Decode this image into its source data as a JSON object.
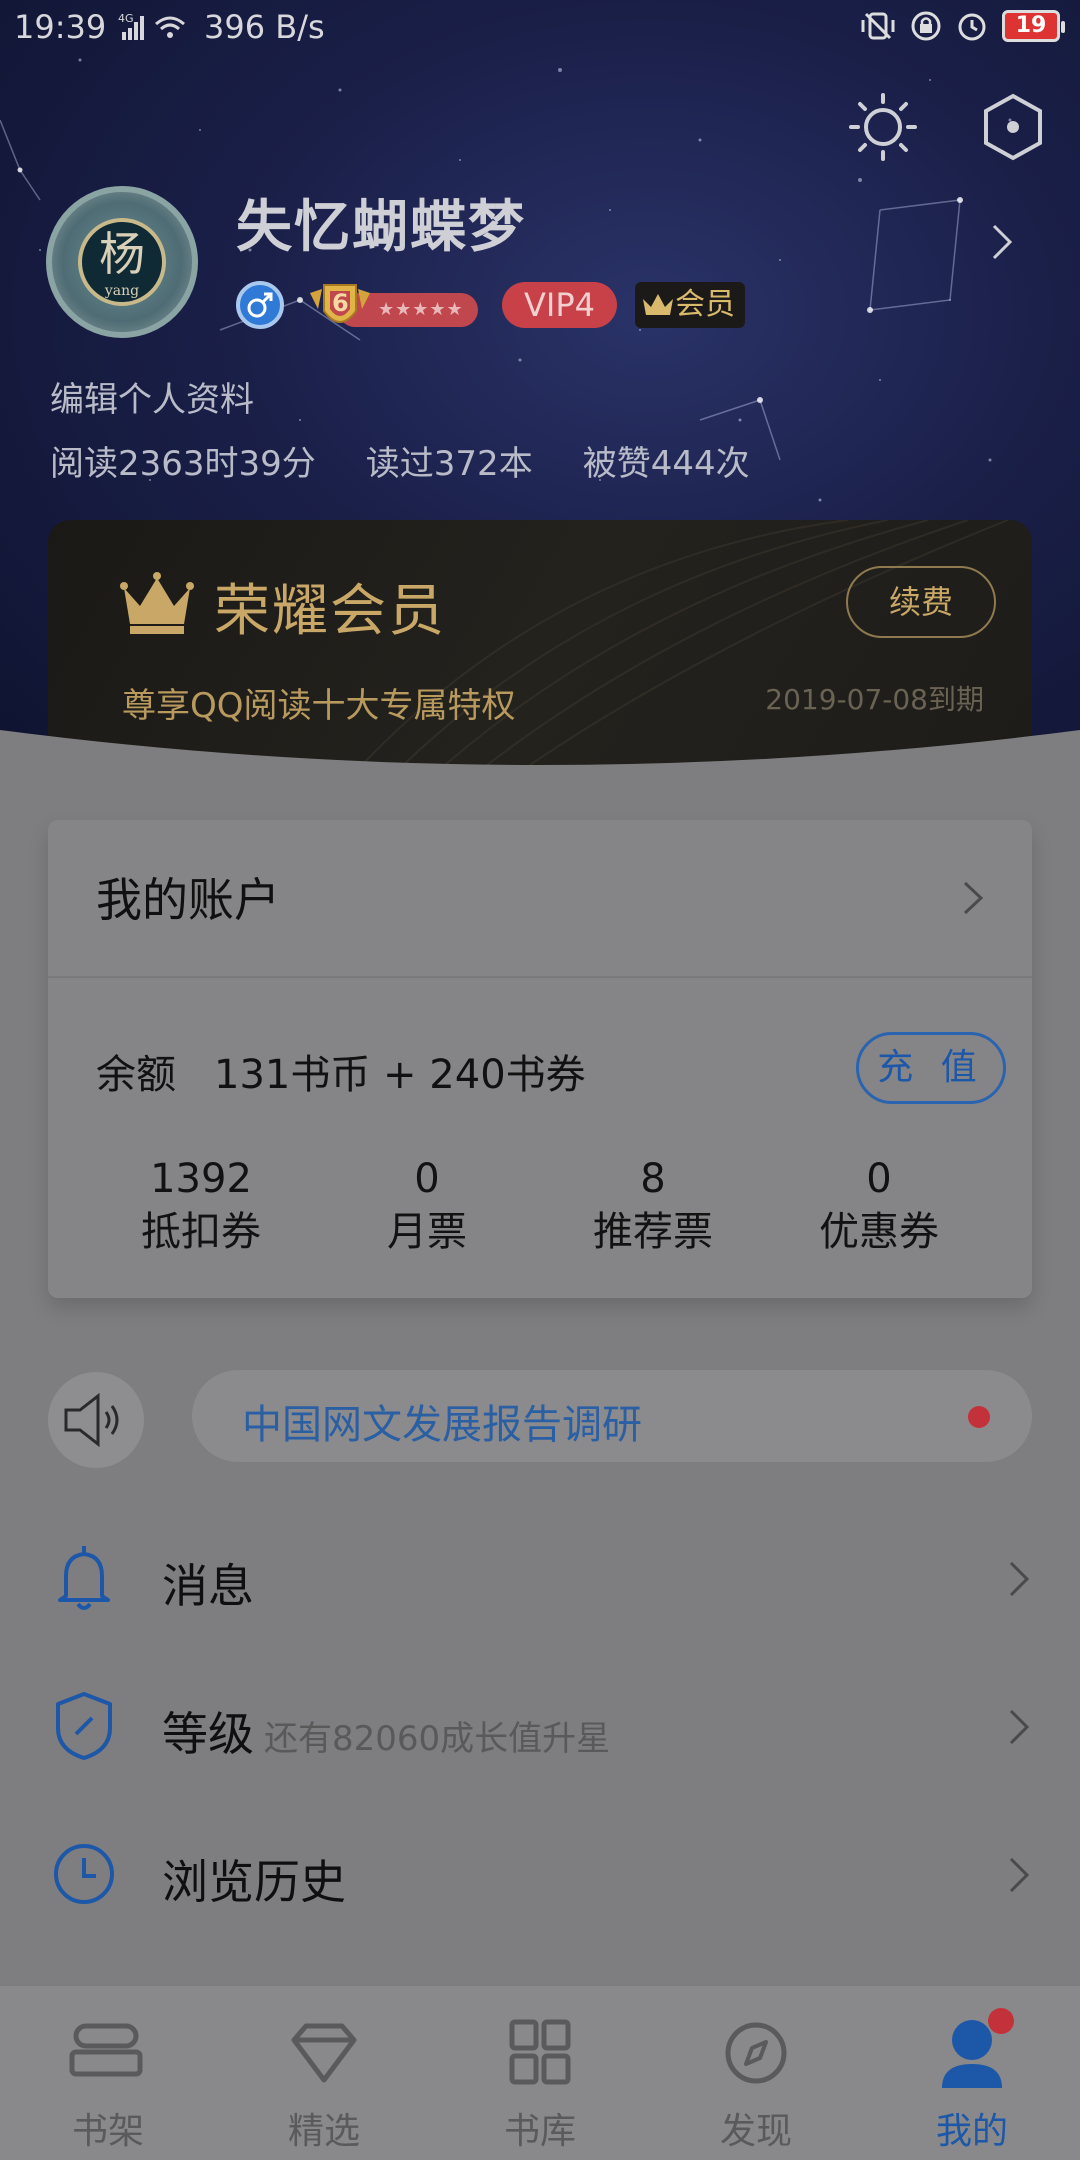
{
  "status_bar": {
    "time": "19:39",
    "network_speed": "396 B/s",
    "network_type": "4G",
    "battery": "19"
  },
  "profile": {
    "username": "失忆蝴蝶梦",
    "avatar_char": "杨",
    "avatar_sub": "yang",
    "level": "6",
    "vip_level": "VIP4",
    "member_label": "会员",
    "edit_label": "编辑个人资料",
    "reading_time": "阅读2363时39分",
    "books_read": "读过372本",
    "likes": "被赞444次"
  },
  "vip_card": {
    "title": "荣耀会员",
    "subtitle": "尊享QQ阅读十大专属特权",
    "expiry": "2019-07-08到期",
    "renew_label": "续费"
  },
  "account": {
    "title": "我的账户",
    "balance_label": "余额",
    "balance_value": "131书币 + 240书券",
    "recharge_label": "充 值",
    "tickets": [
      {
        "value": "1392",
        "label": "抵扣券"
      },
      {
        "value": "0",
        "label": "月票"
      },
      {
        "value": "8",
        "label": "推荐票"
      },
      {
        "value": "0",
        "label": "优惠券"
      }
    ]
  },
  "notice": {
    "text": "中国网文发展报告调研"
  },
  "menu": {
    "messages": "消息",
    "level": "等级",
    "level_sub": "还有82060成长值升星",
    "history": "浏览历史"
  },
  "tabs": [
    {
      "label": "书架",
      "icon": "bookshelf-icon"
    },
    {
      "label": "精选",
      "icon": "diamond-icon"
    },
    {
      "label": "书库",
      "icon": "grid-icon"
    },
    {
      "label": "发现",
      "icon": "compass-icon"
    },
    {
      "label": "我的",
      "icon": "user-icon",
      "active": true
    }
  ],
  "colors": {
    "accent_blue": "#1d57a8",
    "vip_gold": "#c9a867",
    "vip_red": "#c94148",
    "notification_red": "#c3323a"
  }
}
